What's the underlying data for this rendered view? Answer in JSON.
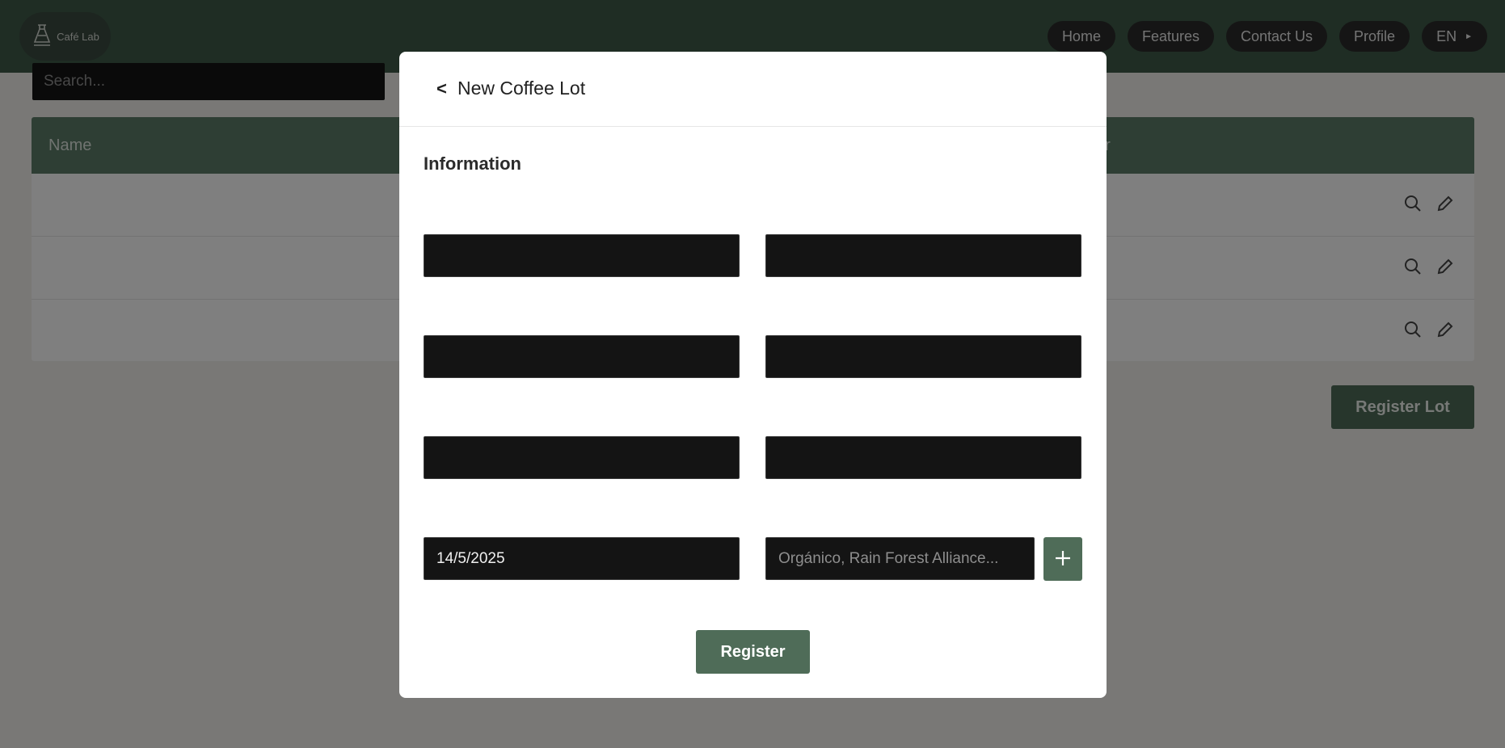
{
  "app": {
    "logo_text": "Café Lab"
  },
  "nav": {
    "items": [
      "Home",
      "Features",
      "Contact Us",
      "Profile"
    ],
    "language": "EN"
  },
  "background": {
    "search_placeholder": "Search...",
    "table": {
      "columns": [
        "Name",
        "er"
      ],
      "row_count": 3
    },
    "register_lot_label": "Register Lot"
  },
  "modal": {
    "back_label": "<",
    "title": "New Coffee Lot",
    "section_title": "Information",
    "fields": {
      "date_value": "14/5/2025",
      "certifications_placeholder": "Orgánico, Rain Forest Alliance..."
    },
    "register_label": "Register"
  },
  "colors": {
    "header_bg": "#3e5a48",
    "accent_green": "#4f6c58",
    "table_header": "#5c7d68",
    "field_bg": "#141414"
  }
}
